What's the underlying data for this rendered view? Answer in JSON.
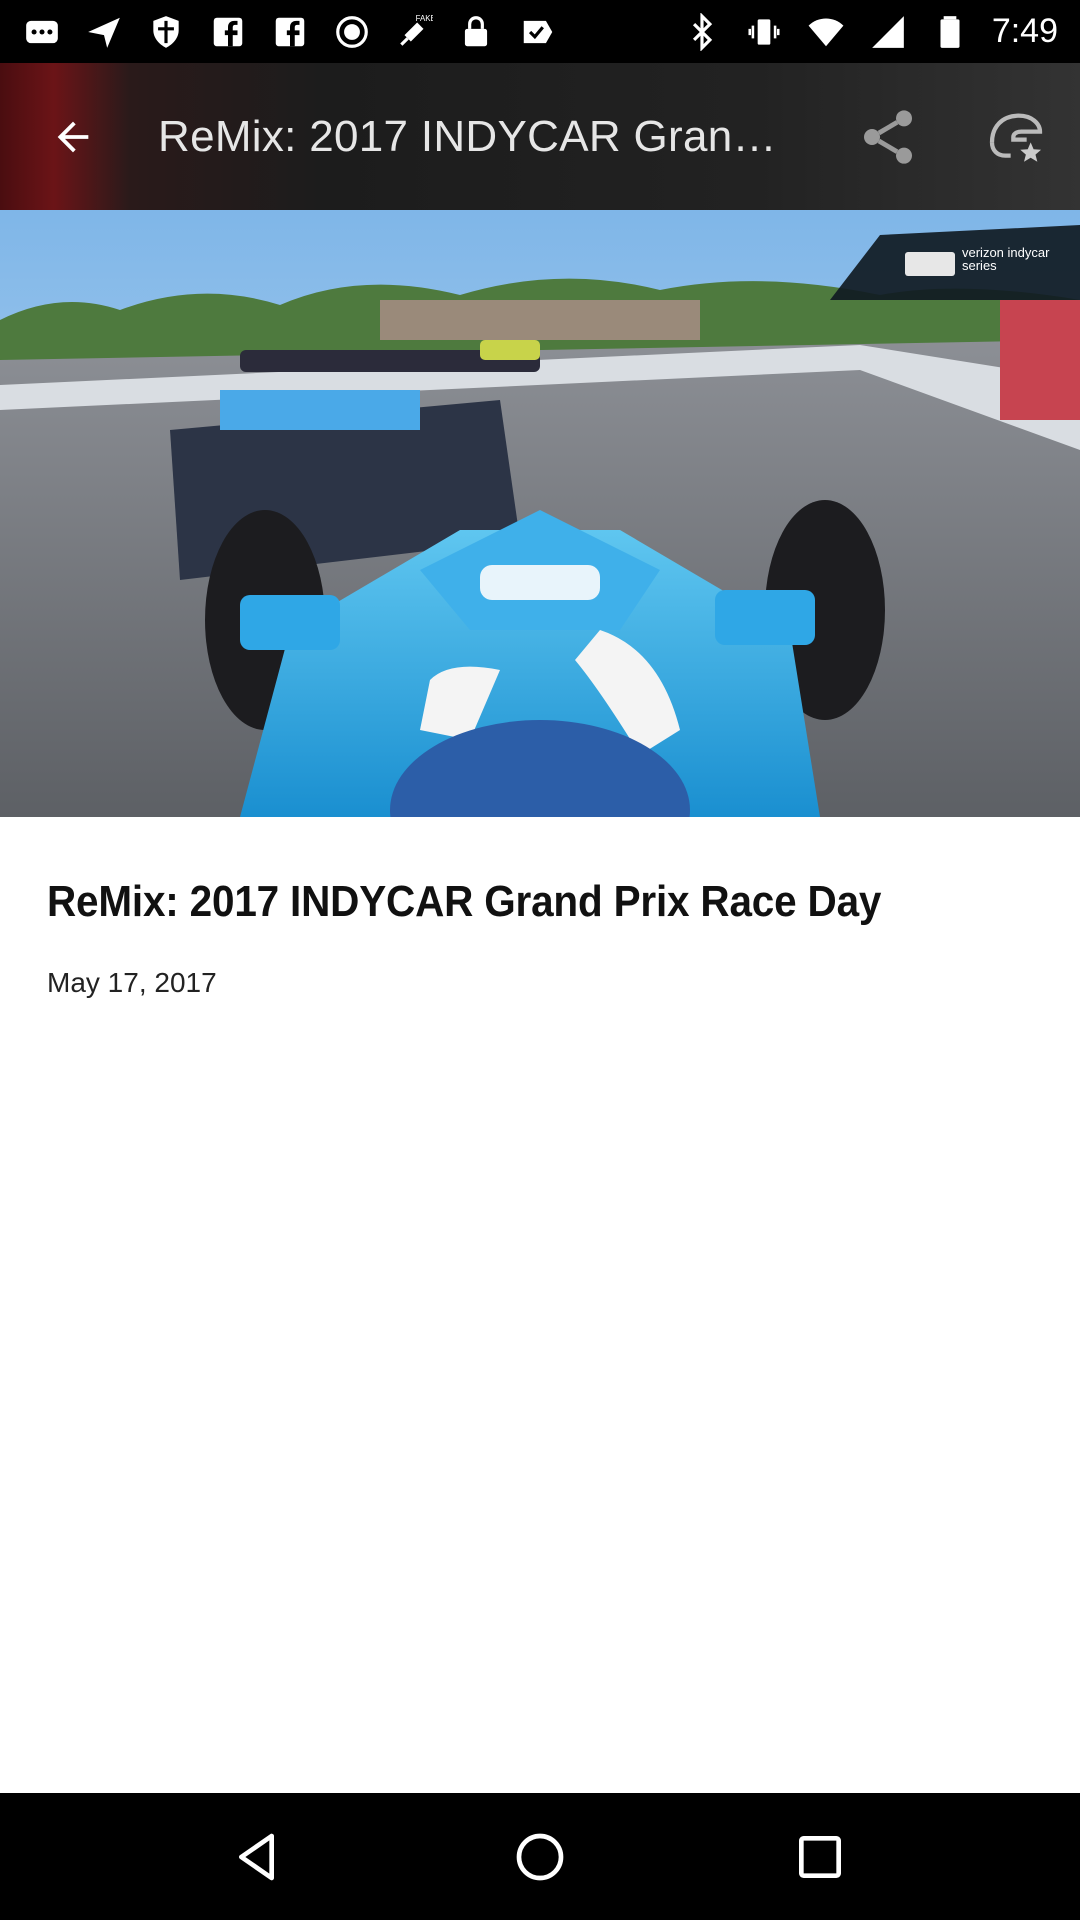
{
  "status_bar": {
    "time": "7:49",
    "icons": [
      "messaging-icon",
      "send-icon",
      "shield-icon",
      "facebook-icon",
      "facebook-icon",
      "record-icon",
      "fake-gps-icon",
      "lock-icon",
      "checklist-icon",
      "bluetooth-icon",
      "vibrate-icon",
      "wifi-icon",
      "signal-icon",
      "battery-icon"
    ]
  },
  "toolbar": {
    "title": "ReMix: 2017 INDYCAR Gran…",
    "back_icon": "arrow-back-icon",
    "share_icon": "share-icon",
    "favorite_icon": "helmet-star-icon"
  },
  "hero": {
    "logo_text": "verizon indycar series"
  },
  "article": {
    "title": "ReMix: 2017 INDYCAR Grand Prix Race Day",
    "date": "May 17, 2017"
  },
  "nav_bar": {
    "icons": [
      "back-triangle-icon",
      "home-circle-icon",
      "recents-square-icon"
    ]
  }
}
